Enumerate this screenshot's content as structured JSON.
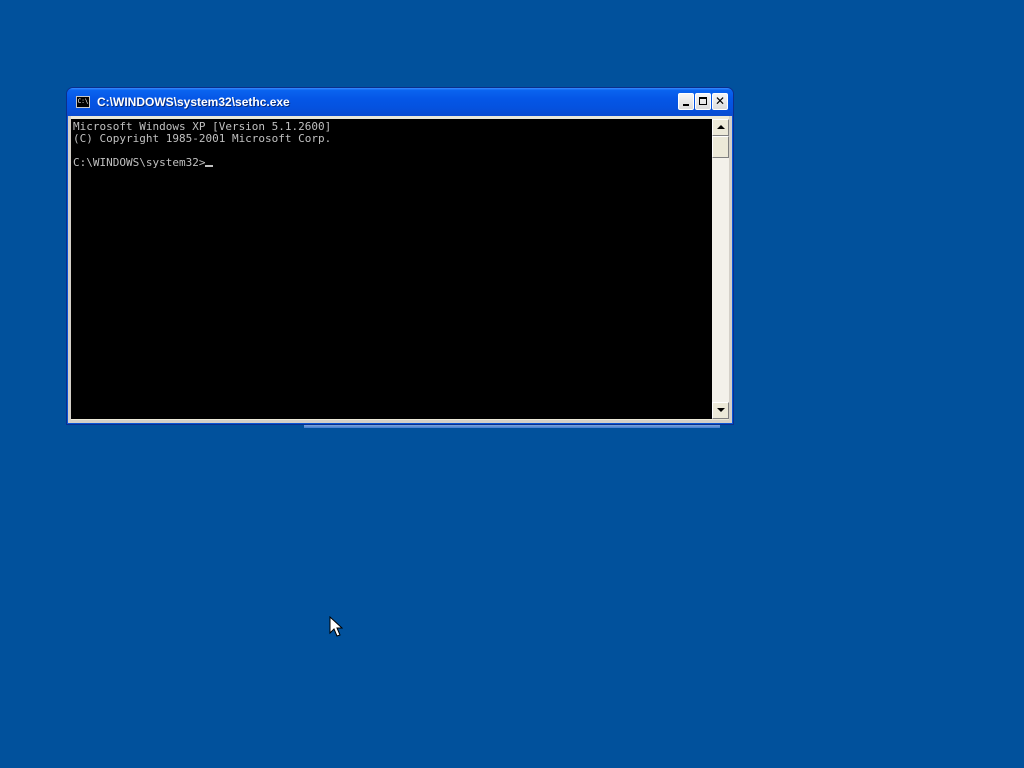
{
  "window": {
    "title": "C:\\WINDOWS\\system32\\sethc.exe",
    "icon_text": "C:\\",
    "buttons": {
      "minimize": "minimize-icon",
      "maximize": "maximize-icon",
      "close": "✕"
    }
  },
  "console": {
    "lines": [
      "Microsoft Windows XP [Version 5.1.2600]",
      "(C) Copyright 1985-2001 Microsoft Corp.",
      "",
      "C:\\WINDOWS\\system32>"
    ],
    "text_color": "#C0C0C0",
    "background_color": "#000000"
  },
  "desktop": {
    "background_color": "#01519C"
  }
}
